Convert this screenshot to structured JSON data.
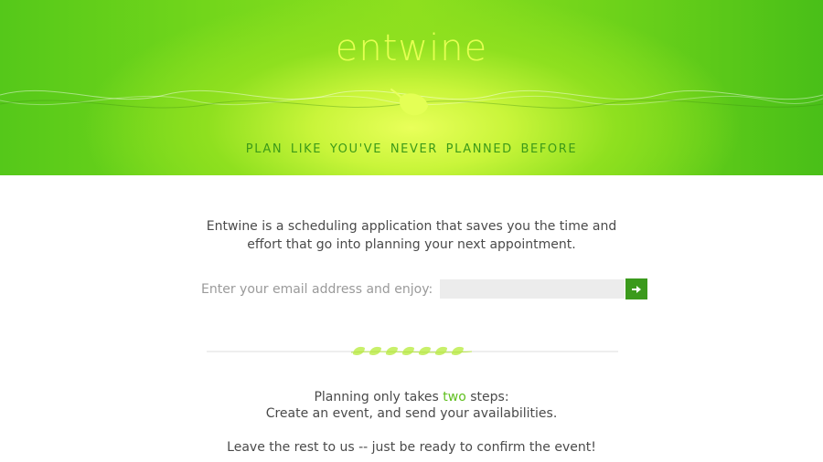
{
  "hero": {
    "logo_text": "entwine",
    "tagline": "PLAN LIKE YOU'VE NEVER PLANNED BEFORE"
  },
  "intro": {
    "line1": "Entwine is a scheduling application that saves you the time and",
    "line2": "effort that go into planning your next appointment."
  },
  "signup": {
    "label": "Enter your email address and enjoy:",
    "email_value": "",
    "submit_icon": "arrow-right-icon"
  },
  "steps": {
    "line1_pre": "Planning only takes ",
    "line1_accent": "two",
    "line1_post": " steps:",
    "line2": "Create an event, and send your availabilities.",
    "line3": "Leave the rest to us -- just be ready to confirm the event!"
  },
  "colors": {
    "logo": "#e4ff52",
    "tagline": "#3c9a18",
    "accent": "#5fbf1e",
    "button": "#3b9a1c",
    "input_bg": "#ececec"
  }
}
